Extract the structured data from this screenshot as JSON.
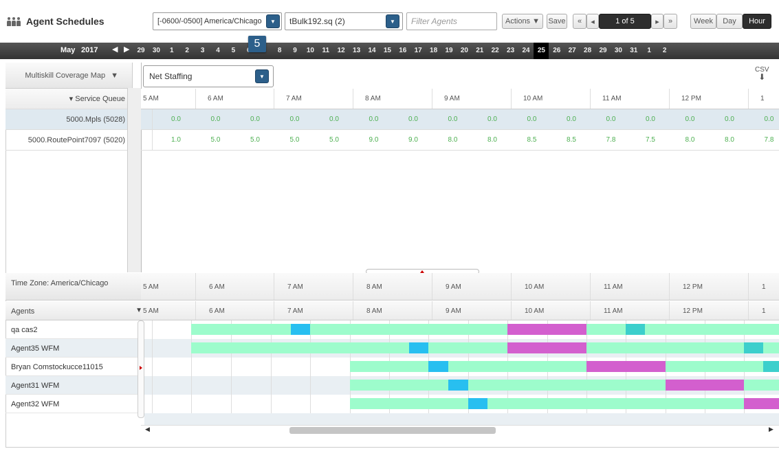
{
  "header": {
    "title": "Agent Schedules",
    "timezone_value": "[-0600/-0500] America/Chicago",
    "file_value": "tBulk192.sq (2)",
    "filter_placeholder": "Filter Agents",
    "actions_label": "Actions ▼",
    "save_label": "Save",
    "page_label": "1 of 5",
    "view_week": "Week",
    "view_day": "Day",
    "view_hour": "Hour"
  },
  "datebar": {
    "month": "May",
    "year": "2017",
    "days": [
      "29",
      "30",
      "1",
      "2",
      "3",
      "4",
      "5",
      "6",
      "7",
      "8",
      "9",
      "10",
      "11",
      "12",
      "13",
      "14",
      "15",
      "16",
      "17",
      "18",
      "19",
      "20",
      "21",
      "22",
      "23",
      "24",
      "25",
      "26",
      "27",
      "28",
      "29",
      "30",
      "31",
      "1",
      "2"
    ],
    "current_day": "25",
    "popup_day": "5"
  },
  "coverage": {
    "map_label": "Multiskill Coverage Map",
    "metric": "Net Staffing",
    "csv_label": "CSV",
    "service_queue_label": "▾ Service Queue",
    "hours": [
      "5 AM",
      "6 AM",
      "7 AM",
      "8 AM",
      "9 AM",
      "10 AM",
      "11 AM",
      "12 PM",
      "1"
    ],
    "rows": [
      {
        "name": "5000.Mpls (5028)",
        "values": [
          "0.0",
          "0.0",
          "0.0",
          "0.0",
          "0.0",
          "0.0",
          "0.0",
          "0.0",
          "0.0",
          "0.0",
          "0.0",
          "0.0",
          "0.0",
          "0.0",
          "0.0",
          "0.0"
        ]
      },
      {
        "name": "5000.RoutePoint7097 (5020)",
        "values": [
          "1.0",
          "5.0",
          "5.0",
          "5.0",
          "5.0",
          "9.0",
          "9.0",
          "8.0",
          "8.0",
          "8.5",
          "8.5",
          "7.8",
          "7.5",
          "8.0",
          "8.0",
          "7.8"
        ]
      }
    ]
  },
  "schedule": {
    "timezone_label": "Time Zone: America/Chicago",
    "agents_label": "Agents",
    "hours": [
      "5 AM",
      "6 AM",
      "7 AM",
      "8 AM",
      "9 AM",
      "10 AM",
      "11 AM",
      "12 PM",
      "1"
    ],
    "agents": [
      "qa cas2",
      "Agent35 WFM",
      "Bryan Comstockucce11015",
      "Agent31 WFM",
      "Agent32 WFM"
    ]
  },
  "colors": {
    "work": "#9dfccc",
    "break": "#28bff0",
    "lunch": "#d35fce",
    "other": "#3ccfcc",
    "accent": "#2c5f8a"
  }
}
